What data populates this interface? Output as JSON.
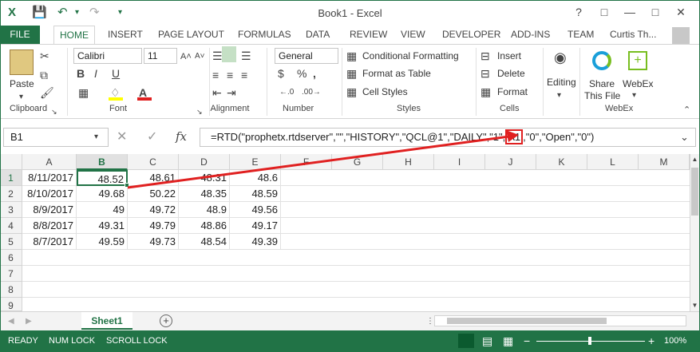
{
  "window": {
    "title": "Book1 - Excel",
    "user": "Curtis Th...",
    "help": "?"
  },
  "ribbon_tabs": [
    "FILE",
    "HOME",
    "INSERT",
    "PAGE LAYOUT",
    "FORMULAS",
    "DATA",
    "REVIEW",
    "VIEW",
    "DEVELOPER",
    "ADD-INS",
    "TEAM"
  ],
  "clipboard": {
    "paste": "Paste",
    "label": "Clipboard"
  },
  "font": {
    "name": "Calibri",
    "size": "11",
    "label": "Font",
    "bold": "B",
    "italic": "I",
    "underline": "U",
    "grow": "A˄",
    "shrink": "A˅"
  },
  "alignment": {
    "label": "Alignment"
  },
  "number": {
    "format": "General",
    "label": "Number",
    "currency": "$",
    "percent": "%",
    "comma": ","
  },
  "styles": {
    "conditional": "Conditional Formatting",
    "format_table": "Format as Table",
    "cell_styles": "Cell Styles",
    "label": "Styles"
  },
  "cells": {
    "insert": "Insert",
    "delete": "Delete",
    "format": "Format",
    "label": "Cells"
  },
  "editing": {
    "label": "Editing"
  },
  "webex": {
    "share": "Share",
    "this_file": "This File",
    "webex": "WebEx",
    "label": "WebEx"
  },
  "formula_bar": {
    "name_box": "B1",
    "fx": "fx",
    "formula_pre": "=RTD(\"prophetx.rtdserver\",\"\",\"HISTORY\",\"QCL@1\",\"DAILY\",\"1\",",
    "formula_ref": "A1",
    "formula_post": ",\"0\",\"Open\",\"0\")"
  },
  "grid": {
    "columns": [
      "A",
      "B",
      "C",
      "D",
      "E",
      "F",
      "G",
      "H",
      "I",
      "J",
      "K",
      "L",
      "M"
    ],
    "rows": [
      "1",
      "2",
      "3",
      "4",
      "5",
      "6",
      "7",
      "8",
      "9"
    ],
    "cells": [
      [
        "8/11/2017",
        "48.52",
        "48.61",
        "48.31",
        "48.6"
      ],
      [
        "8/10/2017",
        "49.68",
        "50.22",
        "48.35",
        "48.59"
      ],
      [
        "8/9/2017",
        "49",
        "49.72",
        "48.9",
        "49.56"
      ],
      [
        "8/8/2017",
        "49.31",
        "49.79",
        "48.86",
        "49.17"
      ],
      [
        "8/7/2017",
        "49.59",
        "49.73",
        "48.54",
        "49.39"
      ]
    ]
  },
  "sheet_tab": "Sheet1",
  "status": {
    "ready": "READY",
    "numlock": "NUM LOCK",
    "scrolllock": "SCROLL LOCK",
    "zoom": "100%"
  },
  "colors": {
    "accent": "#217346",
    "arrow": "#e02020"
  }
}
